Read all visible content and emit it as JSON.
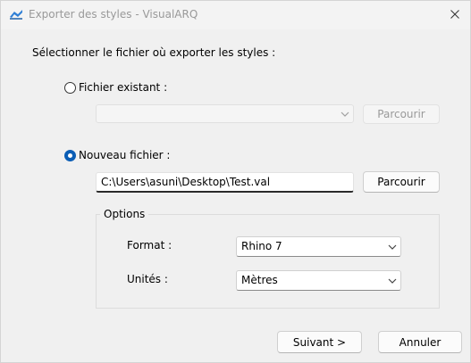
{
  "window": {
    "title": "Exporter des styles - VisualARQ"
  },
  "instruction": "Sélectionner le fichier où exporter les styles :",
  "existing_file": {
    "label": "Fichier existant :",
    "selected": false,
    "value": "",
    "browse_label": "Parcourir"
  },
  "new_file": {
    "label": "Nouveau fichier :",
    "selected": true,
    "path": "C:\\Users\\asuni\\Desktop\\Test.val",
    "browse_label": "Parcourir"
  },
  "options": {
    "title": "Options",
    "format_label": "Format :",
    "format_value": "Rhino 7",
    "units_label": "Unités :",
    "units_value": "Mètres"
  },
  "footer": {
    "next_label": "Suivant >",
    "cancel_label": "Annuler"
  },
  "colors": {
    "accent": "#0a5db5",
    "title_text": "#999999"
  }
}
